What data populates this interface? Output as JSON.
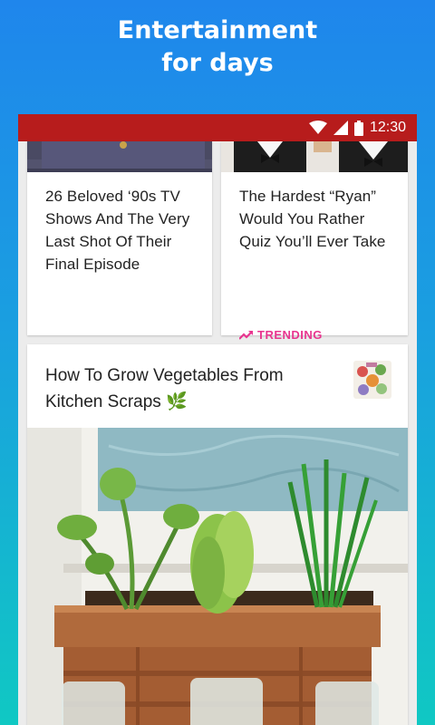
{
  "promo": {
    "title_line1": "Entertainment",
    "title_line2": "for days"
  },
  "status_bar": {
    "time": "12:30",
    "background": "#b71c1c"
  },
  "feed": {
    "cards": [
      {
        "title": "26 Beloved ‘90s TV Shows And The Very Last Shot Of Their Final Episode"
      },
      {
        "title": "The Hardest “Ryan” Would You Rather Quiz You’ll Ever Take",
        "badge": "TRENDING",
        "badge_color": "#e8358f",
        "badge_icon": "trending-up-icon"
      }
    ],
    "feature": {
      "title": "How To Grow Vegetables From Kitchen Scraps",
      "title_emoji": "🌿"
    }
  }
}
